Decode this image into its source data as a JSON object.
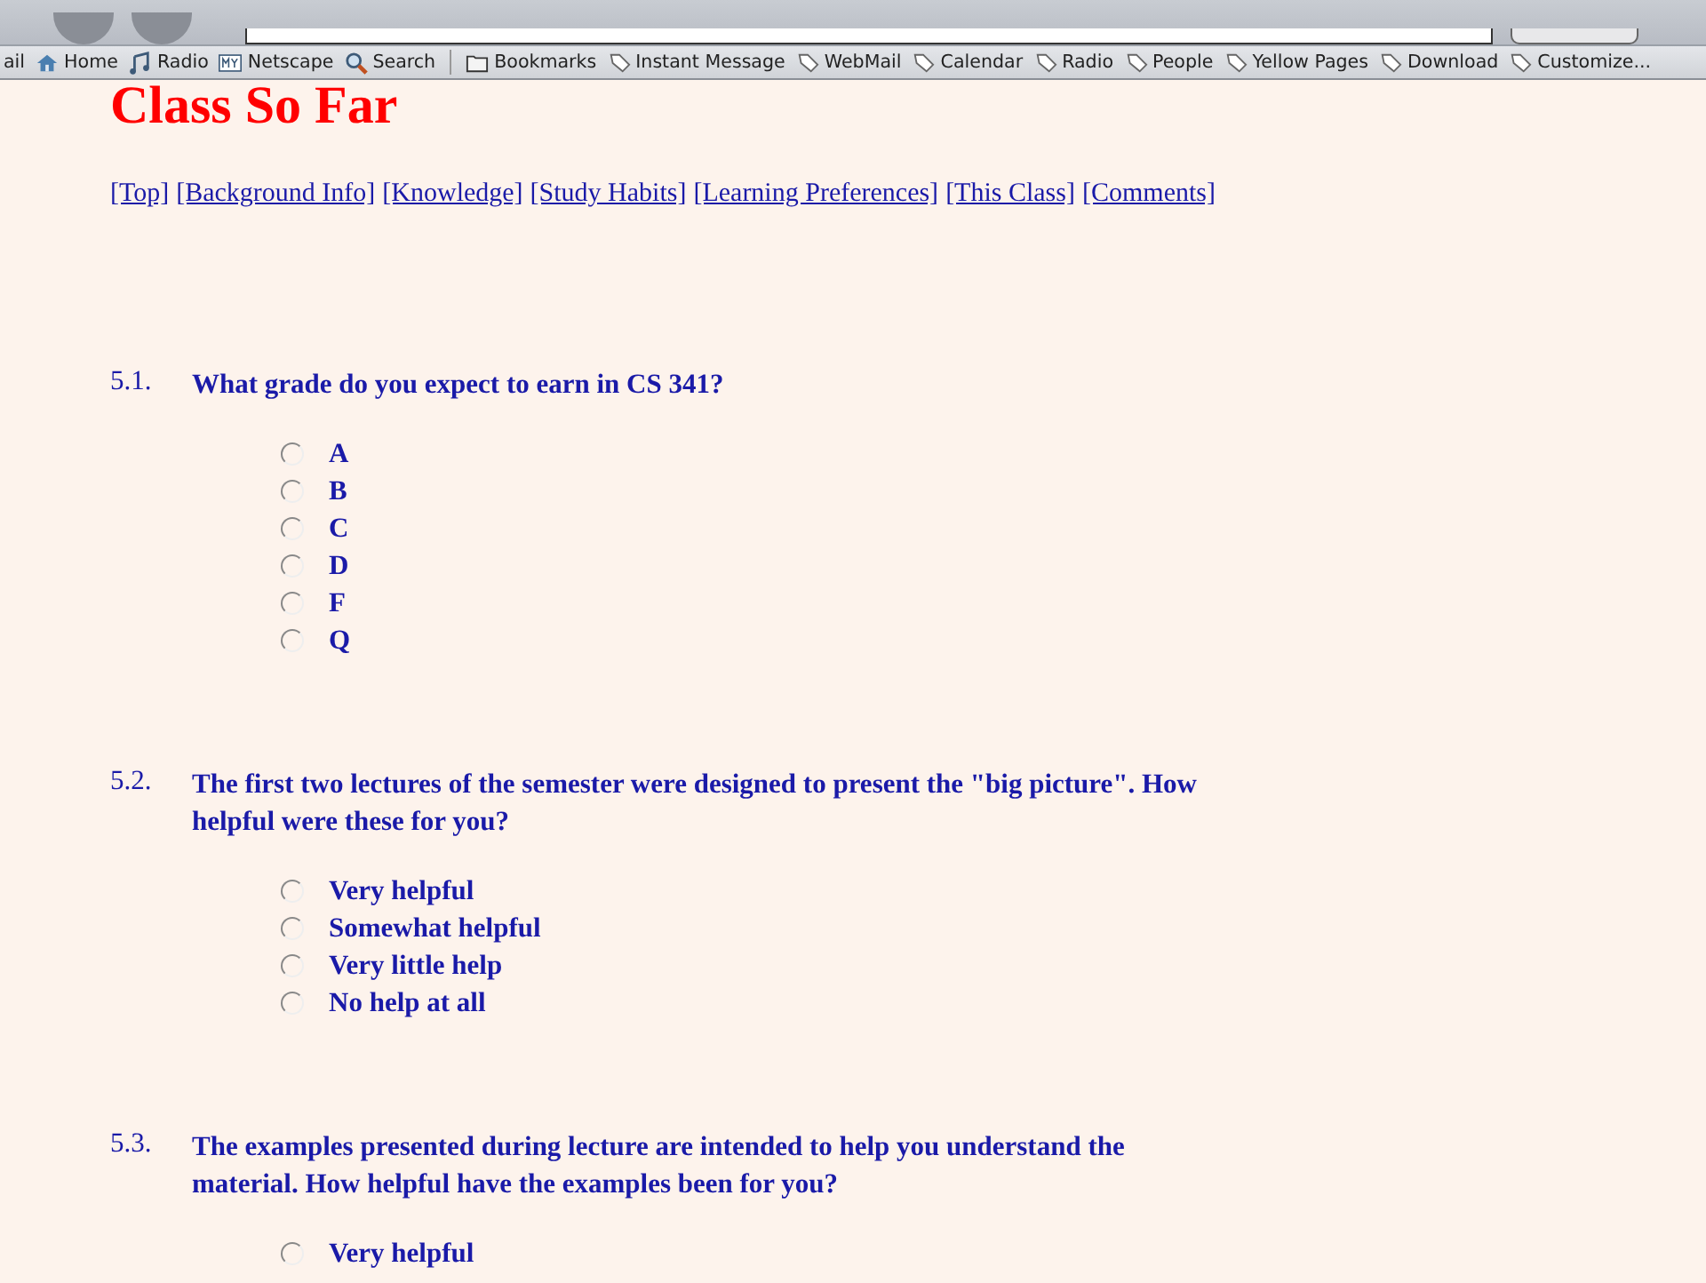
{
  "bookmarks_bar": {
    "items": [
      {
        "label": "ail",
        "kind": "none"
      },
      {
        "label": "Home",
        "kind": "home"
      },
      {
        "label": "Radio",
        "kind": "music"
      },
      {
        "label": "Netscape",
        "kind": "my"
      },
      {
        "label": "Search",
        "kind": "search"
      },
      {
        "label": "Bookmarks",
        "kind": "folder"
      },
      {
        "label": "Instant Message",
        "kind": "bookmark"
      },
      {
        "label": "WebMail",
        "kind": "bookmark"
      },
      {
        "label": "Calendar",
        "kind": "bookmark"
      },
      {
        "label": "Radio",
        "kind": "bookmark"
      },
      {
        "label": "People",
        "kind": "bookmark"
      },
      {
        "label": "Yellow Pages",
        "kind": "bookmark"
      },
      {
        "label": "Download",
        "kind": "bookmark"
      },
      {
        "label": "Customize...",
        "kind": "bookmark"
      }
    ]
  },
  "page": {
    "title": "Class So Far",
    "nav_links": [
      "[Top]",
      "[Background Info]",
      "[Knowledge]",
      "[Study Habits]",
      "[Learning Preferences]",
      "[This Class]",
      "[Comments]"
    ],
    "questions": [
      {
        "number": "5.1.",
        "text": "What grade do you expect to earn in CS 341?",
        "options": [
          {
            "label": "A",
            "selected": false
          },
          {
            "label": "B",
            "selected": false
          },
          {
            "label": "C",
            "selected": false
          },
          {
            "label": "D",
            "selected": false
          },
          {
            "label": "F",
            "selected": false
          },
          {
            "label": "Q",
            "selected": false
          }
        ]
      },
      {
        "number": "5.2.",
        "text": "The first two lectures of the semester were designed to present the \"big picture\". How helpful were these for you?",
        "options": [
          {
            "label": "Very helpful",
            "selected": false
          },
          {
            "label": "Somewhat helpful",
            "selected": false
          },
          {
            "label": "Very little help",
            "selected": false
          },
          {
            "label": "No help at all",
            "selected": false
          }
        ]
      },
      {
        "number": "5.3.",
        "text": "The examples presented during lecture are intended to help you understand the material. How helpful have the examples been for you?",
        "options": [
          {
            "label": "Very helpful",
            "selected": false
          }
        ]
      }
    ]
  }
}
